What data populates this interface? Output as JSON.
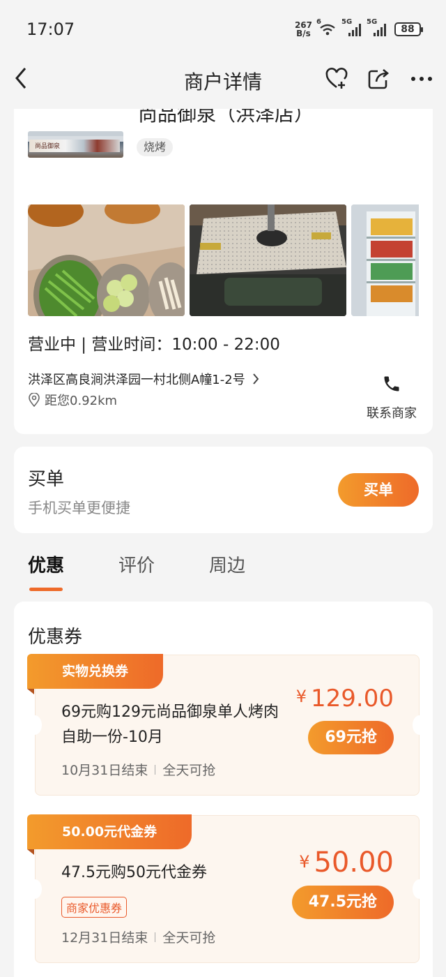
{
  "status_bar": {
    "time": "17:07",
    "net_speed_value": "267",
    "net_speed_unit": "B/s",
    "wifi_label": "6",
    "sim1_label": "5G",
    "sim2_label": "5G",
    "battery": "88"
  },
  "header": {
    "title": "商户详情",
    "back_icon": "chevron-left-icon",
    "favorite_icon": "heart-plus-icon",
    "share_icon": "share-icon",
    "more_icon": "more-icon"
  },
  "shop": {
    "name": "尚品御泉（洪泽店）",
    "category_tag": "烧烤",
    "storefront_sign_text": "尚品御泉",
    "hours": "营业中 | 营业时间：10:00 - 22:00",
    "address": "洪泽区高良涧洪泽园一村北侧A幢1-2号",
    "distance": "距您0.92km",
    "contact_label": "联系商家"
  },
  "pay": {
    "title": "买单",
    "subtitle": "手机买单更便捷",
    "button": "买单"
  },
  "tabs": [
    {
      "label": "优惠",
      "active": true
    },
    {
      "label": "评价",
      "active": false
    },
    {
      "label": "周边",
      "active": false
    }
  ],
  "coupons": {
    "section_title": "优惠券",
    "items": [
      {
        "ribbon": "实物兑换券",
        "title": "69元购129元尚品御泉单人烤肉自助一份-10月",
        "currency": "¥",
        "price": "129.00",
        "grab": "69元抢",
        "end_date": "10月31日结束",
        "availability": "全天可抢"
      },
      {
        "ribbon": "50.00元代金券",
        "title": "47.5元购50元代金券",
        "tag": "商家优惠券",
        "currency": "¥",
        "price": "50.00",
        "grab": "47.5元抢",
        "end_date": "12月31日结束",
        "availability": "全天可抢"
      }
    ]
  },
  "colors": {
    "accent": "#ee6a29",
    "accent_light": "#f39b2c",
    "price": "#e9592a"
  }
}
